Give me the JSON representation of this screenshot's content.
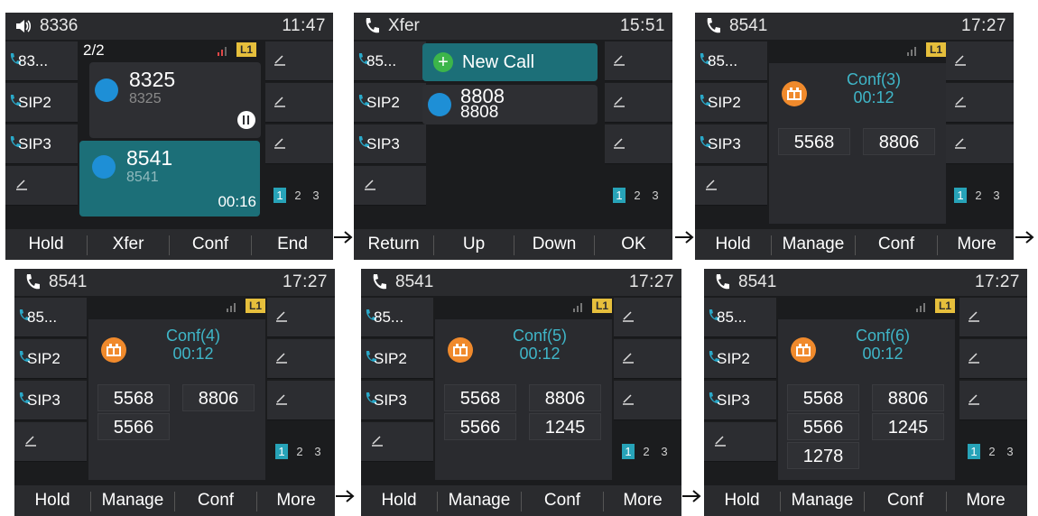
{
  "colors": {
    "accent": "#27a3b8",
    "active_card": "#1c6f78",
    "conf_icon": "#f08a2c",
    "line_badge": "#e6bf3c",
    "phone_icon": "#2aa8c8"
  },
  "icons": {
    "speaker": "speaker-icon",
    "phone": "phone-icon",
    "pen": "pen-icon",
    "pause": "pause-icon",
    "conference": "conference-icon",
    "add": "plus-icon",
    "contact": "contact-icon",
    "signal": "signal-icon"
  },
  "screens": [
    {
      "title": "8336",
      "time": "11:47",
      "lines": [
        "83...",
        "SIP2",
        "SIP3"
      ],
      "call_count": "2/2",
      "line_badge": "L1",
      "calls": [
        {
          "name": "8325",
          "number": "8325",
          "state": "held"
        },
        {
          "name": "8541",
          "number": "8541",
          "duration": "00:16",
          "state": "active"
        }
      ],
      "pages": [
        "1",
        "2",
        "3"
      ],
      "softkeys": [
        "Hold",
        "Xfer",
        "Conf",
        "End"
      ]
    },
    {
      "title": "Xfer",
      "time": "15:51",
      "lines": [
        "85...",
        "SIP2",
        "SIP3"
      ],
      "new_call_label": "New Call",
      "contact": {
        "name": "8808",
        "number": "8808"
      },
      "pages": [
        "1",
        "2",
        "3"
      ],
      "softkeys": [
        "Return",
        "Up",
        "Down",
        "OK"
      ]
    },
    {
      "title": "8541",
      "time": "17:27",
      "lines": [
        "85...",
        "SIP2",
        "SIP3"
      ],
      "line_badge": "L1",
      "conf_title": "Conf(3)",
      "conf_time": "00:12",
      "members": [
        "5568",
        "8806"
      ],
      "pages": [
        "1",
        "2",
        "3"
      ],
      "softkeys": [
        "Hold",
        "Manage",
        "Conf",
        "More"
      ]
    },
    {
      "title": "8541",
      "time": "17:27",
      "lines": [
        "85...",
        "SIP2",
        "SIP3"
      ],
      "line_badge": "L1",
      "conf_title": "Conf(4)",
      "conf_time": "00:12",
      "members": [
        "5568",
        "8806",
        "5566"
      ],
      "pages": [
        "1",
        "2",
        "3"
      ],
      "softkeys": [
        "Hold",
        "Manage",
        "Conf",
        "More"
      ]
    },
    {
      "title": "8541",
      "time": "17:27",
      "lines": [
        "85...",
        "SIP2",
        "SIP3"
      ],
      "line_badge": "L1",
      "conf_title": "Conf(5)",
      "conf_time": "00:12",
      "members": [
        "5568",
        "8806",
        "5566",
        "1245"
      ],
      "pages": [
        "1",
        "2",
        "3"
      ],
      "softkeys": [
        "Hold",
        "Manage",
        "Conf",
        "More"
      ]
    },
    {
      "title": "8541",
      "time": "17:27",
      "lines": [
        "85...",
        "SIP2",
        "SIP3"
      ],
      "line_badge": "L1",
      "conf_title": "Conf(6)",
      "conf_time": "00:12",
      "members": [
        "5568",
        "8806",
        "5566",
        "1245",
        "1278"
      ],
      "pages": [
        "1",
        "2",
        "3"
      ],
      "softkeys": [
        "Hold",
        "Manage",
        "Conf",
        "More"
      ]
    }
  ]
}
